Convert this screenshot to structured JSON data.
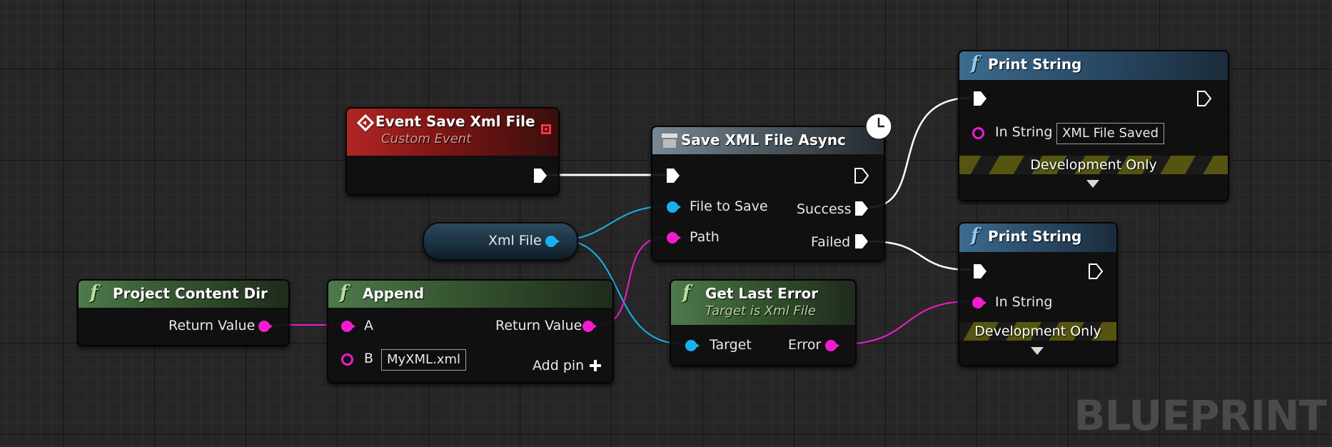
{
  "watermark": "BLUEPRINT",
  "event_node": {
    "title": "Event Save Xml File",
    "subtitle": "Custom Event"
  },
  "async_node": {
    "title": "Save XML File Async",
    "pins": {
      "file_to_save": "File to Save",
      "path": "Path",
      "success": "Success",
      "failed": "Failed"
    }
  },
  "print_top": {
    "title": "Print String",
    "in_string_label": "In String",
    "in_string_value": "XML File Saved",
    "dev_only": "Development Only"
  },
  "print_bottom": {
    "title": "Print String",
    "in_string_label": "In String",
    "dev_only": "Development Only"
  },
  "xml_var": {
    "label": "Xml File"
  },
  "content_dir": {
    "title": "Project Content Dir",
    "return_label": "Return Value"
  },
  "append_node": {
    "title": "Append",
    "a_label": "A",
    "b_label": "B",
    "b_value": "MyXML.xml",
    "return_label": "Return Value",
    "add_pin": "Add pin"
  },
  "last_error": {
    "title": "Get Last Error",
    "subtitle": "Target is Xml File",
    "target_label": "Target",
    "error_label": "Error"
  },
  "colors": {
    "exec": "#ffffff",
    "object_pin": "#1ab0f0",
    "string_pin": "#f21ccf",
    "dev_stripe": "#555511"
  }
}
